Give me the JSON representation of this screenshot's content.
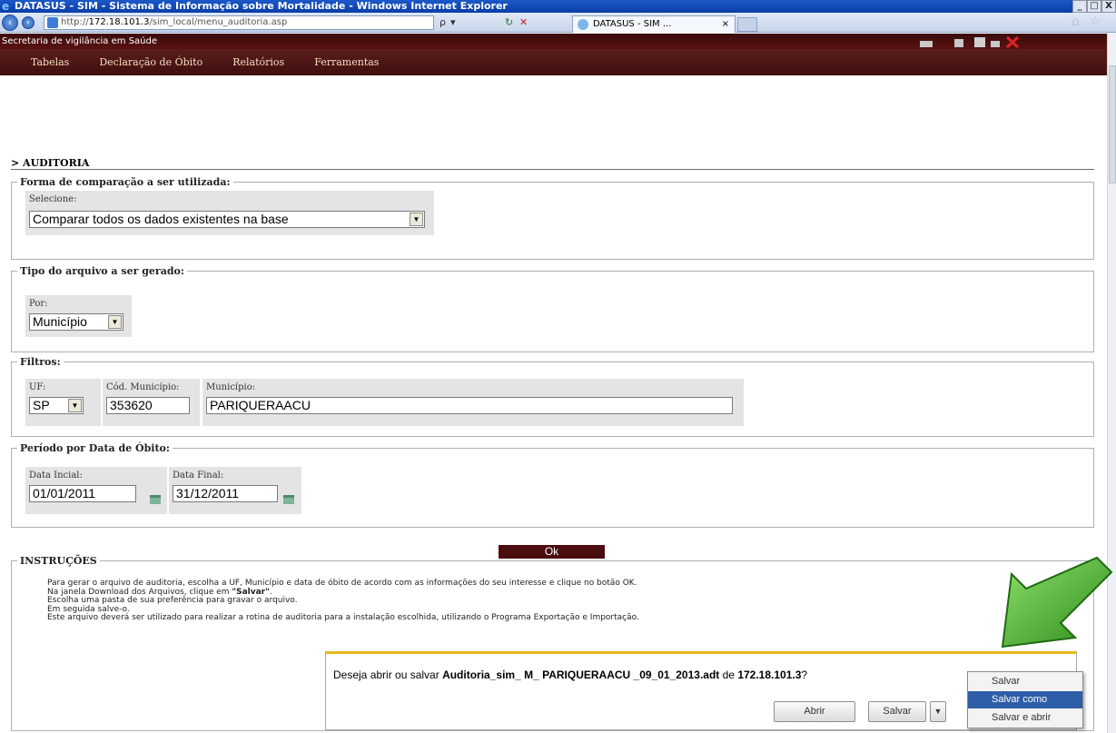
{
  "window": {
    "title": "DATASUS - SIM - Sistema de Informação sobre Mortalidade - Windows Internet Explorer",
    "btn_min": "_",
    "btn_max": "□",
    "btn_close": "X"
  },
  "browser": {
    "url_prefix": "http://",
    "url_host": "172.18.101.3",
    "url_path": "/sim_local/menu_auditoria.asp",
    "search_glyph": "ρ",
    "dropdown_glyph": "▾",
    "refresh_glyph": "↻",
    "stop_glyph": "✕",
    "tab_title": "DATASUS - SIM ...",
    "tab_close": "×"
  },
  "app": {
    "banner": "Secretaria de vigilância em Saúde",
    "menu": [
      "Tabelas",
      "Declaração de Óbito",
      "Relatórios",
      "Ferramentas"
    ]
  },
  "page": {
    "breadcrumb": "> AUDITORIA",
    "comparacao": {
      "legend": "Forma de comparação a ser utilizada:",
      "label": "Selecione:",
      "value": "Comparar todos os dados existentes na base"
    },
    "tipo": {
      "legend": "Tipo do arquivo a ser gerado:",
      "label": "Por:",
      "value": "Município"
    },
    "filtros": {
      "legend": "Filtros:",
      "uf_label": "UF:",
      "uf_value": "SP",
      "cod_label": "Cód. Município:",
      "cod_value": "353620",
      "mun_label": "Município:",
      "mun_value": "PARIQUERAACU"
    },
    "periodo": {
      "legend": "Período por Data de Óbito:",
      "ini_label": "Data Incial:",
      "ini_value": "01/01/2011",
      "fim_label": "Data Final:",
      "fim_value": "31/12/2011"
    },
    "ok_label": "Ok",
    "instrucoes": {
      "legend": "INSTRUÇÕES",
      "l1": "Para gerar o arquivo de auditoria, escolha a UF, Município e data de óbito de acordo com as informações do seu interesse e clique no botão OK.",
      "l2_pre": "Na janela Download dos Arquivos, clique em ",
      "l2_bold": "\"Salvar\"",
      "l2_post": ".",
      "l3": "Escolha uma pasta de sua preferência para gravar o arquivo.",
      "l4": "Em seguida salve-o.",
      "l5": "Este arquivo deverá ser utilizado para realizar a rotina de auditoria para a instalação escolhida, utilizando o Programa Exportação e Importação."
    }
  },
  "download_bar": {
    "msg_pre": "Deseja abrir ou salvar ",
    "file": "Auditoria_sim_ M_ PARIQUERAACU _09_01_2013.adt",
    "msg_mid": " de ",
    "host": "172.18.101.3",
    "msg_post": "?",
    "open_label": "Abrir",
    "save_label": "Salvar",
    "save_menu": [
      "Salvar",
      "Salvar como",
      "Salvar e abrir"
    ]
  },
  "colors": {
    "menu_bg": "#4a1212",
    "ok_bg": "#4b0d0d",
    "arrow": "#3fa52a",
    "highlight": "#2f5ea8",
    "download_border": "#e6b720"
  }
}
